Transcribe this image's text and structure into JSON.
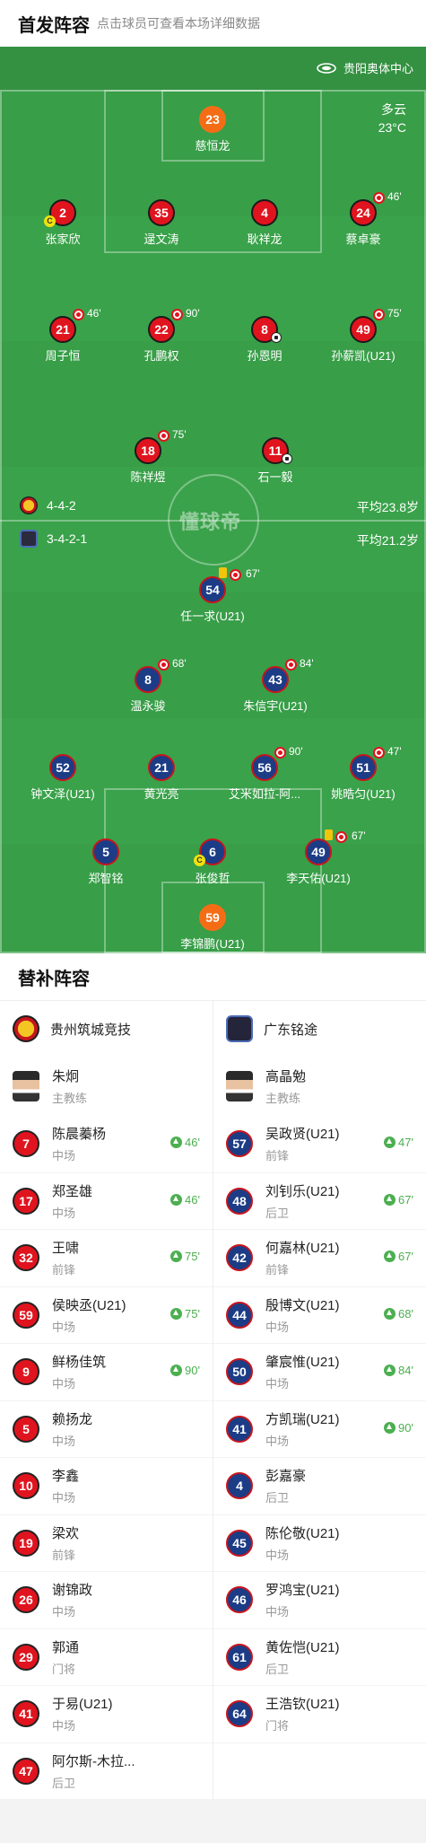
{
  "header": {
    "title": "首发阵容",
    "subtitle": "点击球员可查看本场详细数据"
  },
  "pitch": {
    "venue": "贵阳奥体中心",
    "weather": "多云",
    "temperature": "23°C",
    "watermark": "懂球帝",
    "home_formation": "4-4-2",
    "home_avg_age": "平均23.8岁",
    "away_formation": "3-4-2-1",
    "away_avg_age": "平均21.2岁"
  },
  "home_lineup": [
    {
      "num": "23",
      "name": "慈恒龙",
      "gk": true
    },
    {
      "num": "2",
      "name": "张家欣",
      "captain": true
    },
    {
      "num": "35",
      "name": "逯文涛"
    },
    {
      "num": "4",
      "name": "耿祥龙"
    },
    {
      "num": "24",
      "name": "蔡卓豪",
      "sub_out": "46'"
    },
    {
      "num": "21",
      "name": "周子恒",
      "sub_out": "46'"
    },
    {
      "num": "22",
      "name": "孔鹏权",
      "sub_out": "90'"
    },
    {
      "num": "8",
      "name": "孙恩明",
      "goal": true
    },
    {
      "num": "49",
      "name": "孙薪凯(U21)",
      "sub_out": "75'"
    },
    {
      "num": "18",
      "name": "陈祥煜",
      "sub_out": "75'"
    },
    {
      "num": "11",
      "name": "石一毅",
      "goal": true
    }
  ],
  "away_lineup": [
    {
      "num": "54",
      "name": "任一求(U21)",
      "sub_out": "67'",
      "yellow": true
    },
    {
      "num": "8",
      "name": "温永骏",
      "sub_out": "68'"
    },
    {
      "num": "43",
      "name": "朱信宇(U21)",
      "sub_out": "84'"
    },
    {
      "num": "52",
      "name": "钟文泽(U21)"
    },
    {
      "num": "21",
      "name": "黄光亮"
    },
    {
      "num": "56",
      "name": "艾米如拉-阿...",
      "sub_out": "90'"
    },
    {
      "num": "51",
      "name": "姚晧匀(U21)",
      "sub_out": "47'"
    },
    {
      "num": "5",
      "name": "郑智铭"
    },
    {
      "num": "6",
      "name": "张俊哲",
      "captain": true
    },
    {
      "num": "49",
      "name": "李天佑(U21)",
      "sub_out": "67'",
      "yellow": true
    },
    {
      "num": "59",
      "name": "李锦鹏(U21)",
      "gk": true
    }
  ],
  "subs_section": {
    "title": "替补阵容"
  },
  "home_team": {
    "name": "贵州筑城竞技",
    "coach": {
      "name": "朱炯",
      "role": "主教练"
    },
    "subs": [
      {
        "num": "7",
        "name": "陈晨蓁杨",
        "pos": "中场",
        "in": "46'"
      },
      {
        "num": "17",
        "name": "郑圣雄",
        "pos": "中场",
        "in": "46'"
      },
      {
        "num": "32",
        "name": "王啸",
        "pos": "前锋",
        "in": "75'"
      },
      {
        "num": "59",
        "name": "侯映丞(U21)",
        "pos": "中场",
        "in": "75'"
      },
      {
        "num": "9",
        "name": "鲜杨佳筑",
        "pos": "中场",
        "in": "90'"
      },
      {
        "num": "5",
        "name": "赖扬龙",
        "pos": "中场"
      },
      {
        "num": "10",
        "name": "李鑫",
        "pos": "中场"
      },
      {
        "num": "19",
        "name": "梁欢",
        "pos": "前锋"
      },
      {
        "num": "26",
        "name": "谢锦政",
        "pos": "中场"
      },
      {
        "num": "29",
        "name": "郭通",
        "pos": "门将"
      },
      {
        "num": "41",
        "name": "于易(U21)",
        "pos": "中场"
      },
      {
        "num": "47",
        "name": "阿尔斯-木拉...",
        "pos": "后卫"
      }
    ]
  },
  "away_team": {
    "name": "广东铭途",
    "coach": {
      "name": "高晶勉",
      "role": "主教练"
    },
    "subs": [
      {
        "num": "57",
        "name": "吴政贤(U21)",
        "pos": "前锋",
        "in": "47'"
      },
      {
        "num": "48",
        "name": "刘钊乐(U21)",
        "pos": "后卫",
        "in": "67'"
      },
      {
        "num": "42",
        "name": "何嘉林(U21)",
        "pos": "前锋",
        "in": "67'"
      },
      {
        "num": "44",
        "name": "殷博文(U21)",
        "pos": "中场",
        "in": "68'"
      },
      {
        "num": "50",
        "name": "肇宸惟(U21)",
        "pos": "中场",
        "in": "84'"
      },
      {
        "num": "41",
        "name": "方凯瑞(U21)",
        "pos": "中场",
        "in": "90'"
      },
      {
        "num": "4",
        "name": "彭嘉豪",
        "pos": "后卫"
      },
      {
        "num": "45",
        "name": "陈伦敬(U21)",
        "pos": "中场"
      },
      {
        "num": "46",
        "name": "罗鸿宝(U21)",
        "pos": "中场"
      },
      {
        "num": "61",
        "name": "黄佐恺(U21)",
        "pos": "后卫"
      },
      {
        "num": "64",
        "name": "王浩钦(U21)",
        "pos": "门将"
      }
    ]
  }
}
